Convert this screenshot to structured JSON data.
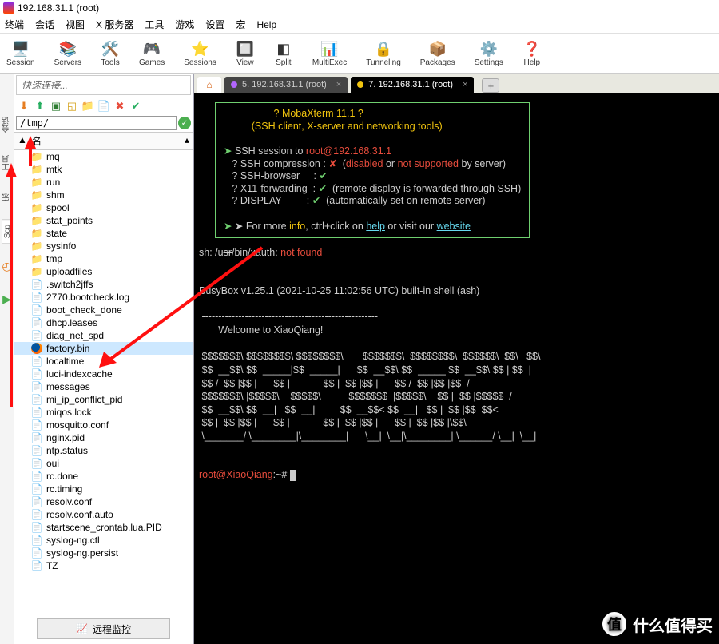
{
  "title": "192.168.31.1 (root)",
  "menus": [
    "终端",
    "会话",
    "视图",
    "X 服务器",
    "工具",
    "游戏",
    "设置",
    "宏",
    "Help"
  ],
  "toolbar": [
    {
      "icon": "🖥️",
      "label": "Session"
    },
    {
      "icon": "📚",
      "label": "Servers"
    },
    {
      "icon": "🛠️",
      "label": "Tools"
    },
    {
      "icon": "🎮",
      "label": "Games"
    },
    {
      "icon": "⭐",
      "label": "Sessions"
    },
    {
      "icon": "🔲",
      "label": "View"
    },
    {
      "icon": "◧",
      "label": "Split"
    },
    {
      "icon": "📊",
      "label": "MultiExec"
    },
    {
      "icon": "🔒",
      "label": "Tunneling"
    },
    {
      "icon": "📦",
      "label": "Packages"
    },
    {
      "icon": "⚙️",
      "label": "Settings"
    },
    {
      "icon": "❓",
      "label": "Help"
    }
  ],
  "quick_connect": "快速连接...",
  "path": "/tmp/",
  "name_header": "名",
  "vtabs": {
    "session": "会话",
    "tool": "工具",
    "macro": "宏",
    "scp": "Scp"
  },
  "files": [
    {
      "n": "mq",
      "t": "d"
    },
    {
      "n": "mtk",
      "t": "d"
    },
    {
      "n": "run",
      "t": "d"
    },
    {
      "n": "shm",
      "t": "d"
    },
    {
      "n": "spool",
      "t": "d"
    },
    {
      "n": "stat_points",
      "t": "d"
    },
    {
      "n": "state",
      "t": "d"
    },
    {
      "n": "sysinfo",
      "t": "d"
    },
    {
      "n": "tmp",
      "t": "d"
    },
    {
      "n": "uploadfiles",
      "t": "d"
    },
    {
      "n": ".switch2jffs",
      "t": "f"
    },
    {
      "n": "2770.bootcheck.log",
      "t": "f"
    },
    {
      "n": "boot_check_done",
      "t": "f"
    },
    {
      "n": "dhcp.leases",
      "t": "f"
    },
    {
      "n": "diag_net_spd",
      "t": "f"
    },
    {
      "n": "factory.bin",
      "t": "fx",
      "sel": true
    },
    {
      "n": "localtime",
      "t": "f"
    },
    {
      "n": "luci-indexcache",
      "t": "f"
    },
    {
      "n": "messages",
      "t": "f"
    },
    {
      "n": "mi_ip_conflict_pid",
      "t": "f"
    },
    {
      "n": "miqos.lock",
      "t": "f"
    },
    {
      "n": "mosquitto.conf",
      "t": "f"
    },
    {
      "n": "nginx.pid",
      "t": "f"
    },
    {
      "n": "ntp.status",
      "t": "f"
    },
    {
      "n": "oui",
      "t": "f"
    },
    {
      "n": "rc.done",
      "t": "f"
    },
    {
      "n": "rc.timing",
      "t": "f"
    },
    {
      "n": "resolv.conf",
      "t": "f"
    },
    {
      "n": "resolv.conf.auto",
      "t": "f"
    },
    {
      "n": "startscene_crontab.lua.PID",
      "t": "f"
    },
    {
      "n": "syslog-ng.ctl",
      "t": "f"
    },
    {
      "n": "syslog-ng.persist",
      "t": "f"
    },
    {
      "n": "TZ",
      "t": "f"
    }
  ],
  "remote_monitor": "远程监控",
  "tabs": [
    {
      "label": "5. 192.168.31.1 (root)",
      "color": "#b366ff",
      "active": false
    },
    {
      "label": "7. 192.168.31.1 (root)",
      "color": "#f1c40f",
      "active": true
    }
  ],
  "term": {
    "banner_title": "? MobaXterm 11.1 ?",
    "banner_sub": "(SSH client, X-server and networking tools)",
    "session_to_pre": "SSH session to ",
    "session_to_user": "root",
    "session_to_host": "@192.168.31.1",
    "l_comp": "? SSH compression : ",
    "comp_val": "✘",
    "comp_txt": "(disabled or not supported by server)",
    "l_brw": "? SSH-browser     : ",
    "brw_val": "✔",
    "l_x11": "? X11-forwarding  : ",
    "x11_val": "✔",
    "x11_txt": "(remote display is forwarded through SSH)",
    "l_disp": "? DISPLAY         : ",
    "disp_val": "✔",
    "disp_txt": "(automatically set on remote server)",
    "info_pre": "➤ For more ",
    "info": "info",
    "info_mid": ", ctrl+click on ",
    "help": "help",
    "info_mid2": " or visit our ",
    "website": "website",
    "xauth": "sh: /usr/bin/xauth: not found",
    "busybox": "BusyBox v1.25.1 (2021-10-25 11:02:56 UTC) built-in shell (ash)",
    "dashes": " -----------------------------------------------------",
    "welcome": "       Welcome to XiaoQiang!",
    "art1": " $$$$$$$\\ $$$$$$$$\\ $$$$$$$$\\       $$$$$$$\\  $$$$$$$$\\  $$$$$$\\  $$\\   $$\\",
    "art2": " $$  __$$\\ $$  _____|$$  _____|      $$  __$$\\ $$  _____|$$  __$$\\ $$ | $$  |",
    "art3": " $$ /  $$ |$$ |      $$ |            $$ |  $$ |$$ |      $$ /  $$ |$$ |$$  /",
    "art4": " $$$$$$$\\ |$$$$$\\    $$$$$\\          $$$$$$$  |$$$$$\\    $$ |  $$ |$$$$$  /",
    "art5": " $$  __$$\\ $$  __|   $$  __|         $$  __$$< $$  __|   $$ |  $$ |$$  $$<",
    "art6": " $$ |  $$ |$$ |      $$ |            $$ |  $$ |$$ |      $$ |  $$ |$$ |\\$$\\",
    "art7": " \\_______/ \\________|\\________|      \\__|  \\__|\\________| \\______/ \\__|  \\__|",
    "prompt_user": "root@XiaoQiang",
    "prompt_tail": ":~# "
  },
  "watermark": "什么值得买",
  "watermark_badge": "值"
}
